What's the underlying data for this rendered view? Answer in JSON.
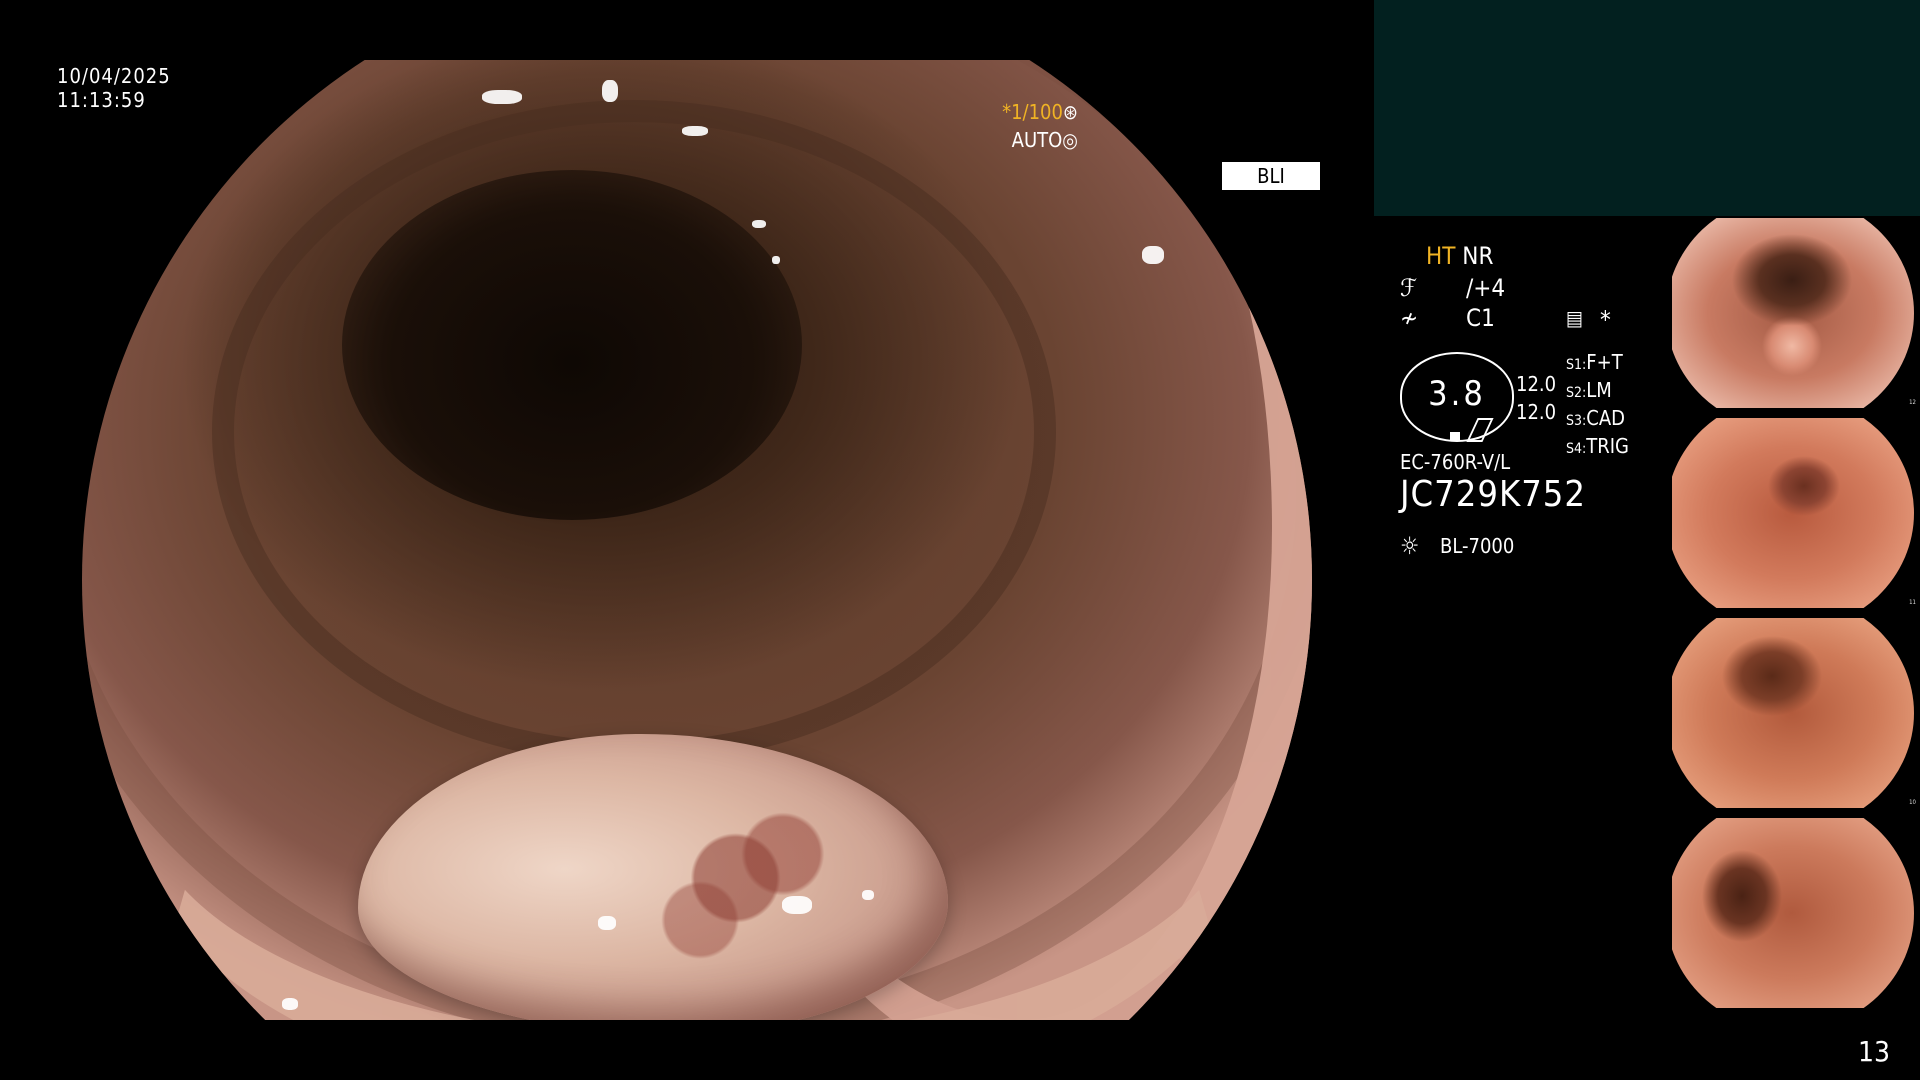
{
  "overlay": {
    "date": "10/04/2025",
    "time": "11:13:59",
    "shutter": "*1/100",
    "shutter_icon": "shutter-icon",
    "iris_mode": "AUTO",
    "iris_icon": "iris-icon",
    "light_mode": "BLI"
  },
  "panel": {
    "ht": "HT",
    "nr": "NR",
    "enhancement_value": "/+4",
    "color_value": "C1",
    "star": "*",
    "scope_value": "3.8",
    "scale_top": "12.0",
    "scale_bottom": "12.0",
    "settings": [
      {
        "key": "S1:",
        "value": "F+T"
      },
      {
        "key": "S2:",
        "value": "LM"
      },
      {
        "key": "S3:",
        "value": "CAD"
      },
      {
        "key": "S4:",
        "value": "TRIG"
      }
    ],
    "scope_model": "EC-760R-V/L",
    "serial": "JC729K752",
    "light_source": "BL-7000"
  },
  "thumbnails": [
    {
      "caption": "12"
    },
    {
      "caption": "11"
    },
    {
      "caption": "10"
    },
    {
      "caption": ""
    }
  ],
  "page_number": "13",
  "colors": {
    "accent": "#f0b324",
    "panel_teal": "#02201f",
    "background": "#000000"
  }
}
